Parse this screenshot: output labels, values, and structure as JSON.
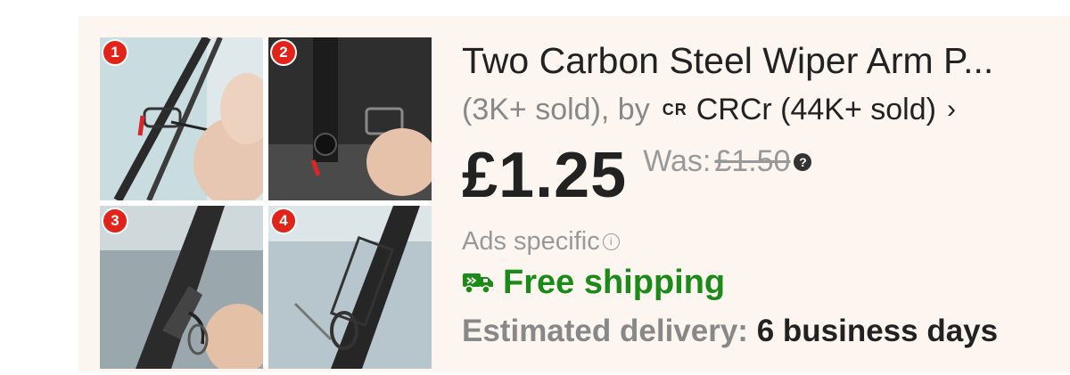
{
  "product": {
    "title": "Two Carbon Steel Wiper Arm P...",
    "sold_count": "(3K+ sold), by",
    "seller_logo": "CR",
    "seller_name": "CRCr (44K+ sold)",
    "chevron": "›",
    "price": "£1.25",
    "was_label": "Was:",
    "was_price": "£1.50",
    "help_glyph": "?",
    "ads_label": "Ads specific",
    "info_glyph": "i",
    "shipping": "Free shipping",
    "delivery_label": "Estimated delivery:",
    "delivery_value": "6 business days"
  },
  "image_steps": [
    "1",
    "2",
    "3",
    "4"
  ],
  "icons": {
    "truck": "truck-icon",
    "help": "question-icon",
    "info": "info-icon",
    "chevron": "chevron-right-icon"
  },
  "colors": {
    "card_bg": "#fdf6f0",
    "shipping_green": "#1a8a18",
    "badge_red": "#e2231a",
    "text_dark": "#222222",
    "text_gray": "#888888"
  }
}
